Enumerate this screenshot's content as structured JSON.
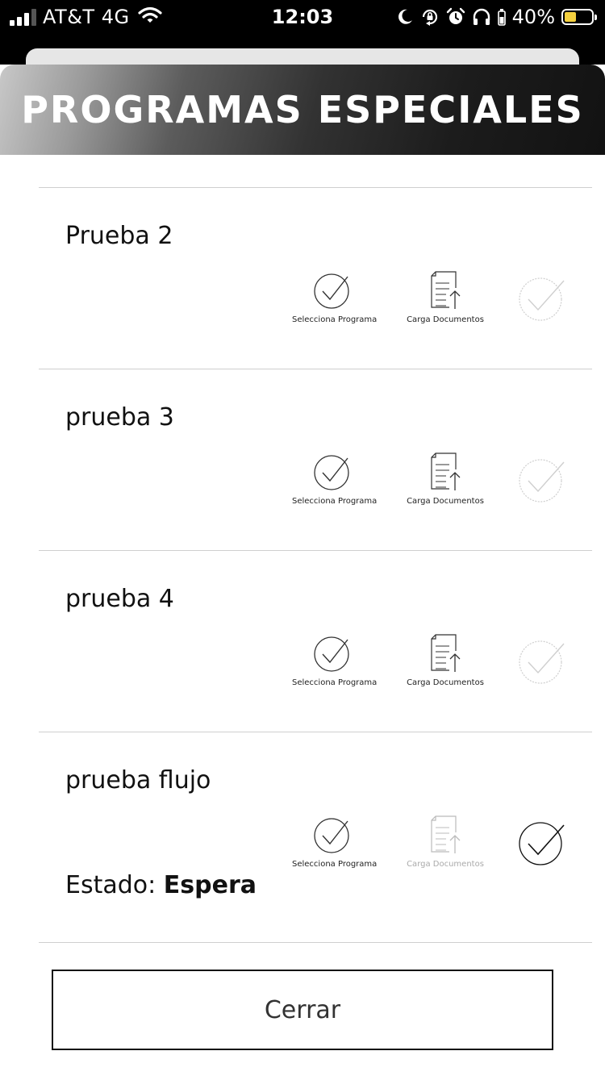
{
  "status_bar": {
    "carrier": "AT&T 4G",
    "time": "12:03",
    "battery_percent": "40%",
    "battery_color": "#f4d03f",
    "icons": [
      "signal-icon",
      "wifi-icon",
      "moon-icon",
      "rotation-lock-icon",
      "alarm-icon",
      "headphones-icon",
      "battery-icon"
    ]
  },
  "header": {
    "title": "PROGRAMAS ESPECIALES"
  },
  "steps": {
    "select_label": "Selecciona Programa",
    "upload_label": "Carga Documentos"
  },
  "programs": [
    {
      "name": "Prueba 2",
      "upload_enabled": true,
      "final_active": false
    },
    {
      "name": "prueba 3",
      "upload_enabled": true,
      "final_active": false
    },
    {
      "name": "prueba 4",
      "upload_enabled": true,
      "final_active": false
    },
    {
      "name": "prueba flujo",
      "upload_enabled": false,
      "final_active": true,
      "status_label": "Estado:",
      "status_value": "Espera"
    }
  ],
  "close_button": {
    "label": "Cerrar"
  }
}
